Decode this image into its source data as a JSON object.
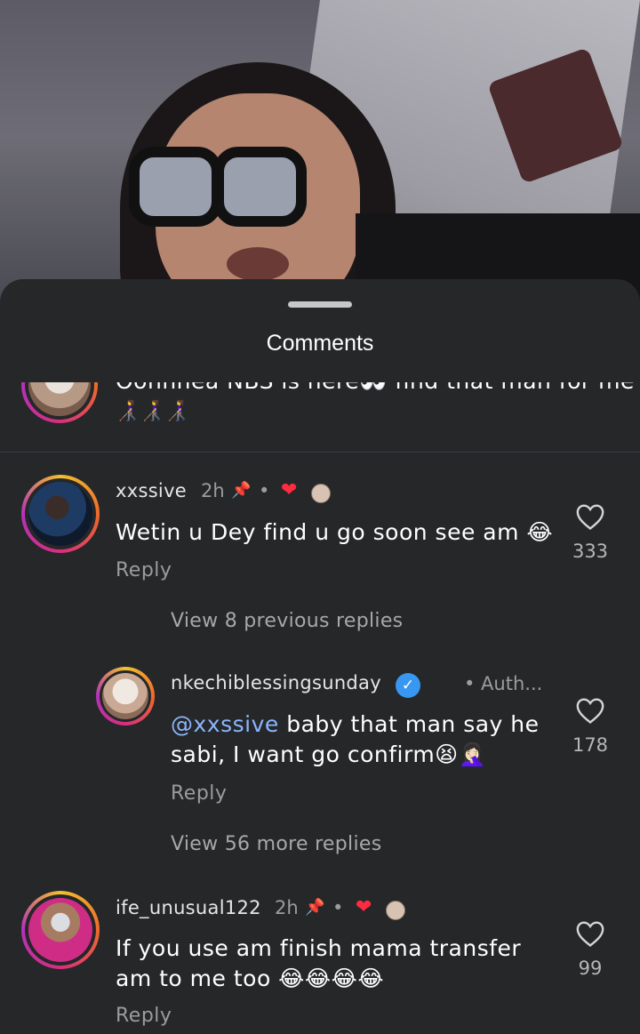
{
  "sheet": {
    "title": "Comments"
  },
  "comments": [
    {
      "text_partial": "Oohhhea NBS is here👀 find that man for me",
      "emoji_line": "👩‍🦯👩‍🦯👩‍🦯"
    },
    {
      "username": "xxssive",
      "time": "2h",
      "text": "Wetin u Dey find u go soon see am 😂",
      "reply_label": "Reply",
      "likes": "333",
      "view_replies": "View 8 previous replies"
    },
    {
      "username": "nkechiblessingsunday",
      "badge": "✓",
      "author_tag": "• Auth...",
      "mention": "@xxssive",
      "text": " baby that man say he sabi, I want go confirm😫🤦🏻‍♀️",
      "reply_label": "Reply",
      "likes": "178",
      "view_replies": "View 56 more replies"
    },
    {
      "username": "ife_unusual122",
      "time": "2h",
      "text": "If you use am finish mama transfer am to me too 😂😂😂😂",
      "reply_label": "Reply",
      "likes": "99"
    }
  ],
  "icons": {
    "pin": "pin-icon",
    "heart": "heart-icon",
    "like": "heart-outline-icon",
    "verified": "verified-badge-icon"
  },
  "colors": {
    "background": "#262729",
    "heart": "#ff2b40",
    "mention": "#8ab6ff",
    "verified": "#3897f0"
  }
}
